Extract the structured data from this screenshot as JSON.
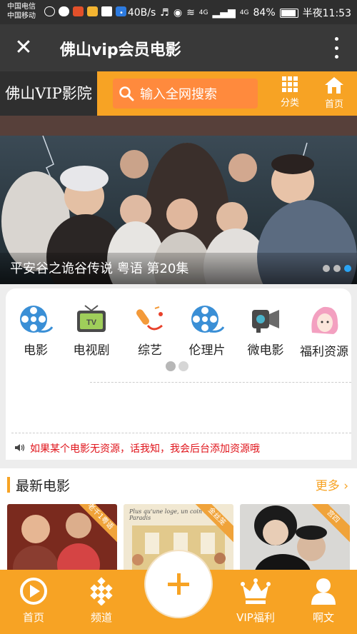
{
  "status_bar": {
    "carrier1": "中国电信",
    "carrier2": "中国移动",
    "speed": "40B/s",
    "signal1": "4G",
    "signal2": "4G",
    "battery": "84%",
    "time": "半夜11:53"
  },
  "titlebar": {
    "title": "佛山vip会员电影",
    "close_icon": "close-icon",
    "more_icon": "more-vertical-icon"
  },
  "header": {
    "logo": "佛山VIP影院",
    "search_placeholder": "输入全网搜索",
    "category_label": "分类",
    "home_label": "首页"
  },
  "banner": {
    "caption": "平安谷之诡谷传说 粤语 第20集",
    "dots": 3,
    "active_dot": 3
  },
  "categories": [
    {
      "label": "电影",
      "icon": "film-reel-icon"
    },
    {
      "label": "电视剧",
      "icon": "tv-icon"
    },
    {
      "label": "综艺",
      "icon": "microphone-icon"
    },
    {
      "label": "伦理片",
      "icon": "film-reel-icon"
    },
    {
      "label": "微电影",
      "icon": "video-camera-icon"
    },
    {
      "label": "福利资源",
      "icon": "woman-icon"
    }
  ],
  "notice": "如果某个电影无资源，话我知，我会后台添加资源哦",
  "latest": {
    "title": "最新电影",
    "more": "更多",
    "posters": [
      {
        "badge": "老千1粤语"
      },
      {
        "badge": "金丝笼",
        "text": "Plus qu'une loge, un coin de Paradis"
      },
      {
        "badge": "宫四"
      }
    ]
  },
  "tabbar": {
    "items": [
      {
        "label": "首页",
        "icon": "play-circle-icon"
      },
      {
        "label": "频道",
        "icon": "grid-icon"
      },
      {
        "label": "VIP福利",
        "icon": "crown-icon"
      },
      {
        "label": "啊文",
        "icon": "user-icon"
      }
    ],
    "center_icon": "plus-icon"
  },
  "colors": {
    "accent": "#f7a324",
    "dark": "#393939",
    "notice": "#e0141b",
    "active_dot": "#2aa4f4"
  }
}
